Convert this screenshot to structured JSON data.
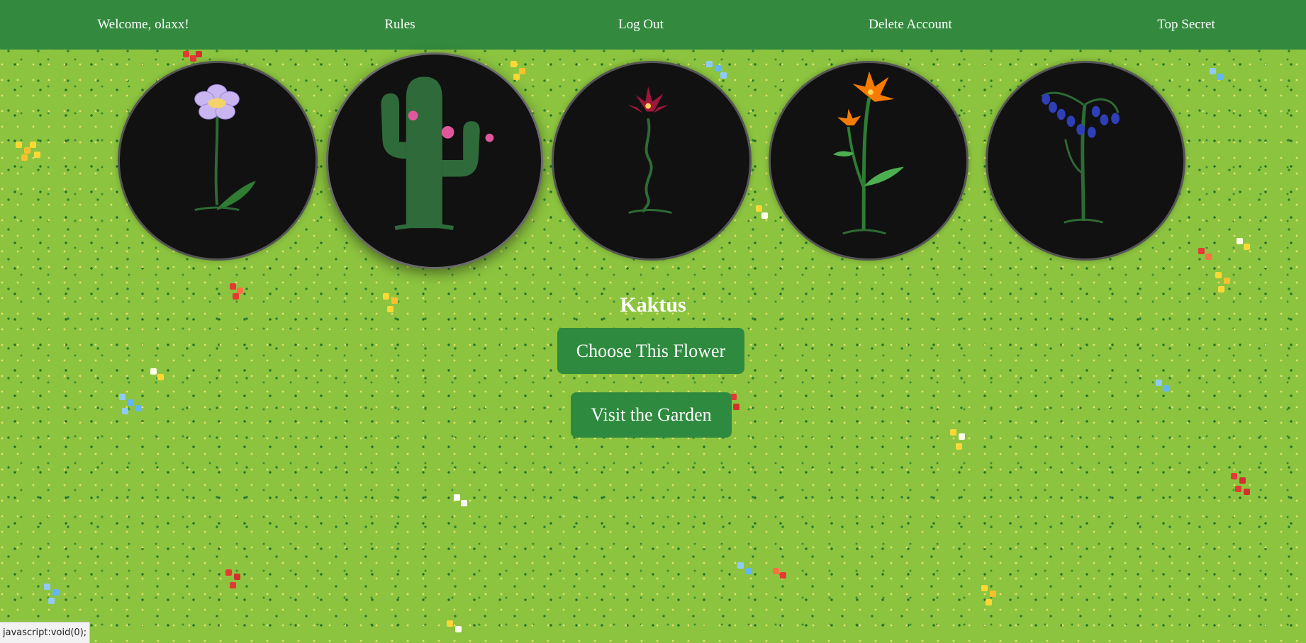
{
  "nav": {
    "welcome": "Welcome, olaxx!",
    "rules": "Rules",
    "logout": "Log Out",
    "delete_account": "Delete Account",
    "top_secret": "Top Secret"
  },
  "flowers": [
    {
      "icon": "daisy-flower-icon"
    },
    {
      "icon": "cactus-icon",
      "selected": true
    },
    {
      "icon": "red-lily-icon"
    },
    {
      "icon": "orange-lily-icon"
    },
    {
      "icon": "bluebell-icon"
    }
  ],
  "selected_flower": {
    "name": "Kaktus"
  },
  "actions": {
    "choose": "Choose This Flower",
    "visit": "Visit the Garden"
  },
  "status_bar": {
    "text": "javascript:void(0);"
  },
  "colors": {
    "nav_background": "#338a3e",
    "button_background": "#2e8a3e",
    "grass": "#8cc43f",
    "circle_fill": "#111111"
  }
}
